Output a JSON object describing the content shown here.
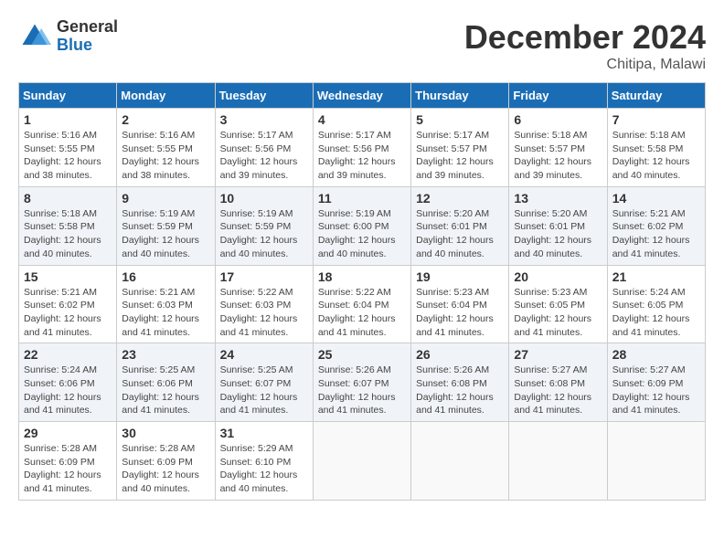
{
  "header": {
    "logo_general": "General",
    "logo_blue": "Blue",
    "month_title": "December 2024",
    "location": "Chitipa, Malawi"
  },
  "weekdays": [
    "Sunday",
    "Monday",
    "Tuesday",
    "Wednesday",
    "Thursday",
    "Friday",
    "Saturday"
  ],
  "weeks": [
    [
      {
        "day": "1",
        "sunrise": "5:16 AM",
        "sunset": "5:55 PM",
        "daylight": "12 hours and 38 minutes."
      },
      {
        "day": "2",
        "sunrise": "5:16 AM",
        "sunset": "5:55 PM",
        "daylight": "12 hours and 38 minutes."
      },
      {
        "day": "3",
        "sunrise": "5:17 AM",
        "sunset": "5:56 PM",
        "daylight": "12 hours and 39 minutes."
      },
      {
        "day": "4",
        "sunrise": "5:17 AM",
        "sunset": "5:56 PM",
        "daylight": "12 hours and 39 minutes."
      },
      {
        "day": "5",
        "sunrise": "5:17 AM",
        "sunset": "5:57 PM",
        "daylight": "12 hours and 39 minutes."
      },
      {
        "day": "6",
        "sunrise": "5:18 AM",
        "sunset": "5:57 PM",
        "daylight": "12 hours and 39 minutes."
      },
      {
        "day": "7",
        "sunrise": "5:18 AM",
        "sunset": "5:58 PM",
        "daylight": "12 hours and 40 minutes."
      }
    ],
    [
      {
        "day": "8",
        "sunrise": "5:18 AM",
        "sunset": "5:58 PM",
        "daylight": "12 hours and 40 minutes."
      },
      {
        "day": "9",
        "sunrise": "5:19 AM",
        "sunset": "5:59 PM",
        "daylight": "12 hours and 40 minutes."
      },
      {
        "day": "10",
        "sunrise": "5:19 AM",
        "sunset": "5:59 PM",
        "daylight": "12 hours and 40 minutes."
      },
      {
        "day": "11",
        "sunrise": "5:19 AM",
        "sunset": "6:00 PM",
        "daylight": "12 hours and 40 minutes."
      },
      {
        "day": "12",
        "sunrise": "5:20 AM",
        "sunset": "6:01 PM",
        "daylight": "12 hours and 40 minutes."
      },
      {
        "day": "13",
        "sunrise": "5:20 AM",
        "sunset": "6:01 PM",
        "daylight": "12 hours and 40 minutes."
      },
      {
        "day": "14",
        "sunrise": "5:21 AM",
        "sunset": "6:02 PM",
        "daylight": "12 hours and 41 minutes."
      }
    ],
    [
      {
        "day": "15",
        "sunrise": "5:21 AM",
        "sunset": "6:02 PM",
        "daylight": "12 hours and 41 minutes."
      },
      {
        "day": "16",
        "sunrise": "5:21 AM",
        "sunset": "6:03 PM",
        "daylight": "12 hours and 41 minutes."
      },
      {
        "day": "17",
        "sunrise": "5:22 AM",
        "sunset": "6:03 PM",
        "daylight": "12 hours and 41 minutes."
      },
      {
        "day": "18",
        "sunrise": "5:22 AM",
        "sunset": "6:04 PM",
        "daylight": "12 hours and 41 minutes."
      },
      {
        "day": "19",
        "sunrise": "5:23 AM",
        "sunset": "6:04 PM",
        "daylight": "12 hours and 41 minutes."
      },
      {
        "day": "20",
        "sunrise": "5:23 AM",
        "sunset": "6:05 PM",
        "daylight": "12 hours and 41 minutes."
      },
      {
        "day": "21",
        "sunrise": "5:24 AM",
        "sunset": "6:05 PM",
        "daylight": "12 hours and 41 minutes."
      }
    ],
    [
      {
        "day": "22",
        "sunrise": "5:24 AM",
        "sunset": "6:06 PM",
        "daylight": "12 hours and 41 minutes."
      },
      {
        "day": "23",
        "sunrise": "5:25 AM",
        "sunset": "6:06 PM",
        "daylight": "12 hours and 41 minutes."
      },
      {
        "day": "24",
        "sunrise": "5:25 AM",
        "sunset": "6:07 PM",
        "daylight": "12 hours and 41 minutes."
      },
      {
        "day": "25",
        "sunrise": "5:26 AM",
        "sunset": "6:07 PM",
        "daylight": "12 hours and 41 minutes."
      },
      {
        "day": "26",
        "sunrise": "5:26 AM",
        "sunset": "6:08 PM",
        "daylight": "12 hours and 41 minutes."
      },
      {
        "day": "27",
        "sunrise": "5:27 AM",
        "sunset": "6:08 PM",
        "daylight": "12 hours and 41 minutes."
      },
      {
        "day": "28",
        "sunrise": "5:27 AM",
        "sunset": "6:09 PM",
        "daylight": "12 hours and 41 minutes."
      }
    ],
    [
      {
        "day": "29",
        "sunrise": "5:28 AM",
        "sunset": "6:09 PM",
        "daylight": "12 hours and 41 minutes."
      },
      {
        "day": "30",
        "sunrise": "5:28 AM",
        "sunset": "6:09 PM",
        "daylight": "12 hours and 40 minutes."
      },
      {
        "day": "31",
        "sunrise": "5:29 AM",
        "sunset": "6:10 PM",
        "daylight": "12 hours and 40 minutes."
      },
      null,
      null,
      null,
      null
    ]
  ],
  "labels": {
    "sunrise": "Sunrise:",
    "sunset": "Sunset:",
    "daylight": "Daylight:"
  }
}
